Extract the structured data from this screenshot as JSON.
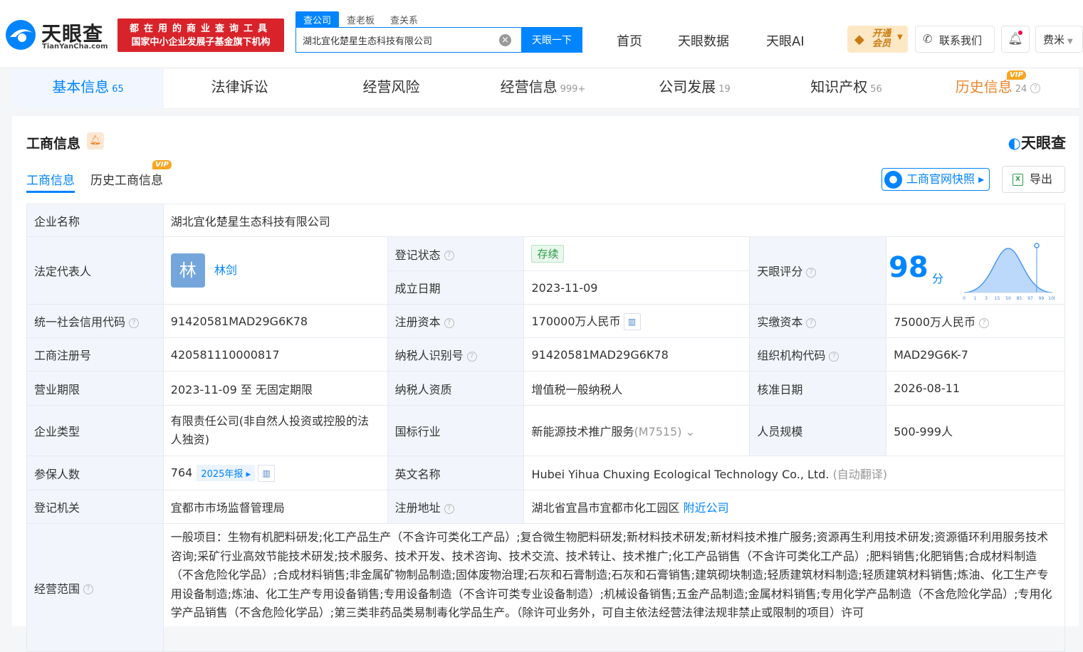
{
  "header": {
    "logo_text": "天眼查",
    "logo_sub": "TianYanCha.com",
    "promo_line1": "都在用的商业查询工具",
    "promo_line2": "国家中小企业发展子基金旗下机构",
    "search_tabs": [
      "查公司",
      "查老板",
      "查关系"
    ],
    "search_value": "湖北宜化楚星生态科技有限公司",
    "search_button": "天眼一下",
    "nav": [
      "首页",
      "天眼数据",
      "天眼AI"
    ],
    "vip_open": "开通会员",
    "contact": "联系我们",
    "user": "费米"
  },
  "main_tabs": [
    {
      "label": "基本信息",
      "count": "65"
    },
    {
      "label": "法律诉讼",
      "count": ""
    },
    {
      "label": "经营风险",
      "count": ""
    },
    {
      "label": "经营信息",
      "count": "999+"
    },
    {
      "label": "公司发展",
      "count": "19"
    },
    {
      "label": "知识产权",
      "count": "56"
    },
    {
      "label": "历史信息",
      "count": "24"
    }
  ],
  "vip_label": "VIP",
  "section": {
    "title": "工商信息",
    "brand": "天眼查",
    "subtabs": [
      "工商信息",
      "历史工商信息"
    ],
    "snapshot_button": "工商官网快照",
    "export_button": "导出"
  },
  "info": {
    "company_name_label": "企业名称",
    "company_name": "湖北宜化楚星生态科技有限公司",
    "legal_rep_label": "法定代表人",
    "legal_rep_avatar": "林",
    "legal_rep": "林剑",
    "reg_status_label": "登记状态",
    "reg_status": "存续",
    "founded_label": "成立日期",
    "founded": "2023-11-09",
    "score_label": "天眼评分",
    "score": "98",
    "score_unit": "分",
    "score_axis": [
      "0",
      "1",
      "3",
      "15",
      "50",
      "85",
      "97",
      "99",
      "100"
    ],
    "credit_code_label": "统一社会信用代码",
    "credit_code": "91420581MAD29G6K78",
    "reg_capital_label": "注册资本",
    "reg_capital": "170000万人民币",
    "paid_capital_label": "实缴资本",
    "paid_capital": "75000万人民币",
    "reg_no_label": "工商注册号",
    "reg_no": "420581110000817",
    "taxpayer_id_label": "纳税人识别号",
    "taxpayer_id": "91420581MAD29G6K78",
    "org_code_label": "组织机构代码",
    "org_code": "MAD29G6K-7",
    "term_label": "营业期限",
    "term": "2023-11-09 至 无固定期限",
    "taxpayer_qual_label": "纳税人资质",
    "taxpayer_qual": "增值税一般纳税人",
    "approve_date_label": "核准日期",
    "approve_date": "2026-08-11",
    "type_label": "企业类型",
    "type": "有限责任公司(非自然人投资或控股的法人独资)",
    "industry_label": "国标行业",
    "industry": "新能源技术推广服务",
    "industry_code": "(M7515)",
    "staff_label": "人员规模",
    "staff": "500-999人",
    "insured_label": "参保人数",
    "insured": "764",
    "insured_year": "2025年报",
    "english_label": "英文名称",
    "english": "Hubei Yihua Chuxing Ecological Technology Co., Ltd.",
    "english_note": "(自动翻译)",
    "authority_label": "登记机关",
    "authority": "宜都市市场监督管理局",
    "address_label": "注册地址",
    "address": "湖北省宜昌市宜都市化工园区",
    "nearby": "附近公司",
    "scope_label": "经营范围",
    "scope": "一般项目：生物有机肥料研发;化工产品生产（不含许可类化工产品）;复合微生物肥料研发;新材料技术研发;新材料技术推广服务;资源再生利用技术研发;资源循环利用服务技术咨询;采矿行业高效节能技术研发;技术服务、技术开发、技术咨询、技术交流、技术转让、技术推广;化工产品销售（不含许可类化工产品）;肥料销售;化肥销售;合成材料制造（不含危险化学品）;合成材料销售;非金属矿物制品制造;固体废物治理;石灰和石膏制造;石灰和石膏销售;建筑砌块制造;轻质建筑材料制造;轻质建筑材料销售;炼油、化工生产专用设备制造;炼油、化工生产专用设备销售;专用设备制造（不含许可类专业设备制造）;机械设备销售;五金产品制造;金属材料销售;专用化学产品制造（不含危险化学品）;专用化学产品销售（不含危险化学品）;第三类非药品类易制毒化学品生产。（除许可业务外，可自主依法经营法律法规非禁止或限制的项目）许可"
  },
  "colors": {
    "accent": "#0084ff",
    "brand_red": "#d8232a",
    "vip_orange": "#e8872c"
  }
}
